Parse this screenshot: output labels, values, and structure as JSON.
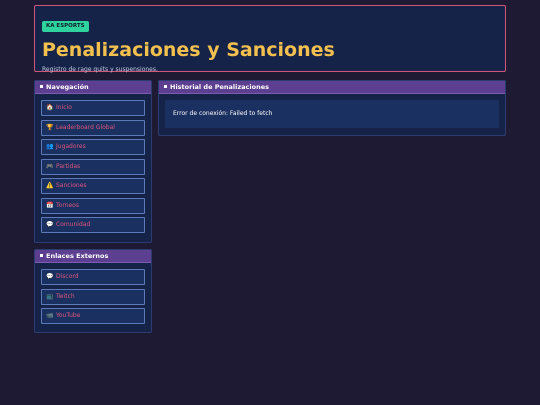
{
  "header": {
    "brand": "KA ESPORTS",
    "title": "Penalizaciones y Sanciones",
    "subtitle": "Registro de rage quits y suspensiones."
  },
  "nav": {
    "title": "Navegación",
    "items": [
      {
        "icon": "🏠",
        "icon_name": "home-icon",
        "label": "Inicio"
      },
      {
        "icon": "🏆",
        "icon_name": "trophy-icon",
        "label": "Leaderboard Global"
      },
      {
        "icon": "👥",
        "icon_name": "users-icon",
        "label": "Jugadores"
      },
      {
        "icon": "🎮",
        "icon_name": "gamepad-icon",
        "label": "Partidas"
      },
      {
        "icon": "⚠️",
        "icon_name": "warning-icon",
        "label": "Sanciones"
      },
      {
        "icon": "📅",
        "icon_name": "calendar-icon",
        "label": "Torneos"
      },
      {
        "icon": "💬",
        "icon_name": "chat-icon",
        "label": "Comunidad"
      }
    ]
  },
  "external": {
    "title": "Enlaces Externos",
    "items": [
      {
        "icon": "💬",
        "icon_name": "discord-icon",
        "label": "Discord"
      },
      {
        "icon": "📺",
        "icon_name": "twitch-icon",
        "label": "Twitch"
      },
      {
        "icon": "📹",
        "icon_name": "youtube-icon",
        "label": "YouTube"
      }
    ]
  },
  "history": {
    "title": "Historial de Penalizaciones",
    "error": "Error de conexión: Failed to fetch"
  },
  "colors": {
    "background": "#1e1a33",
    "panel": "#162348",
    "panel_header": "#5c3f90",
    "title": "#f2c04e",
    "brand_badge": "#2fd39d",
    "link": "#e0567e",
    "header_border": "#d0567a"
  }
}
